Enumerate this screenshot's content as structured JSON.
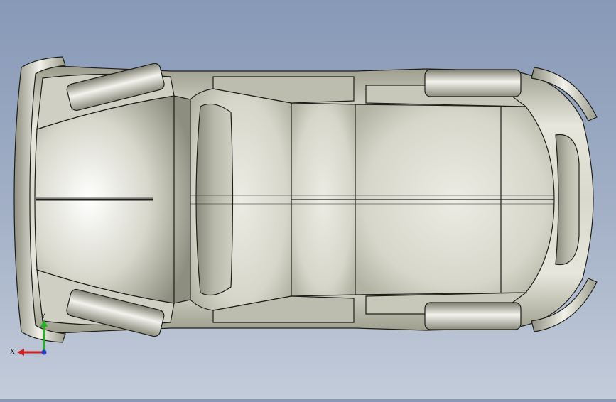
{
  "viewport": {
    "background_top": "#8799b7",
    "background_bottom": "#c3ccda",
    "model": "car-body-top-view",
    "view": "top"
  },
  "triad": {
    "x_label": "X",
    "y_label": "Y",
    "x_color": "#d21f1f",
    "y_color": "#1fb41f",
    "z_color": "#1f3fd2"
  }
}
